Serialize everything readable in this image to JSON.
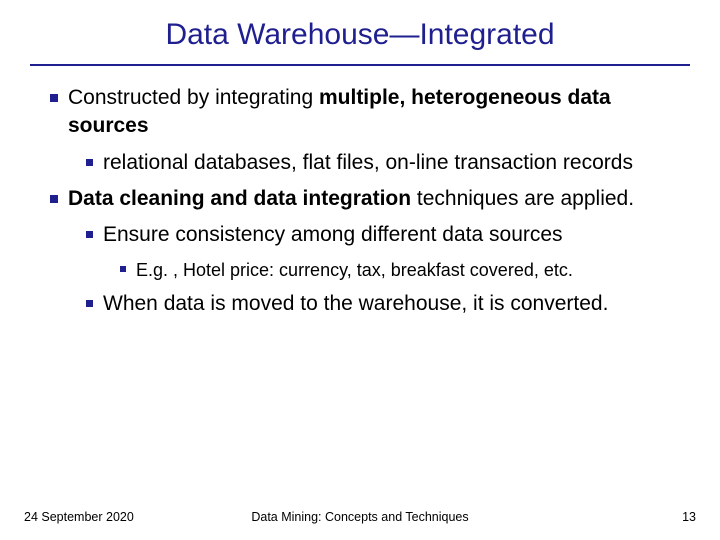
{
  "title": "Data Warehouse—Integrated",
  "bullets": {
    "b1a": "Constructed by integrating ",
    "b1b": "multiple, heterogeneous data sources",
    "b1_1": "relational databases, flat files, on-line transaction records",
    "b2a": "Data cleaning and data integration",
    "b2b": " techniques are applied.",
    "b2_1": "Ensure consistency among different data sources",
    "b2_1_1": "E.g. , Hotel price: currency, tax, breakfast covered, etc.",
    "b2_2": "When data is moved to the warehouse, it is converted."
  },
  "footer": {
    "date": "24 September 2020",
    "mid": "Data Mining: Concepts and Techniques",
    "page": "13"
  }
}
